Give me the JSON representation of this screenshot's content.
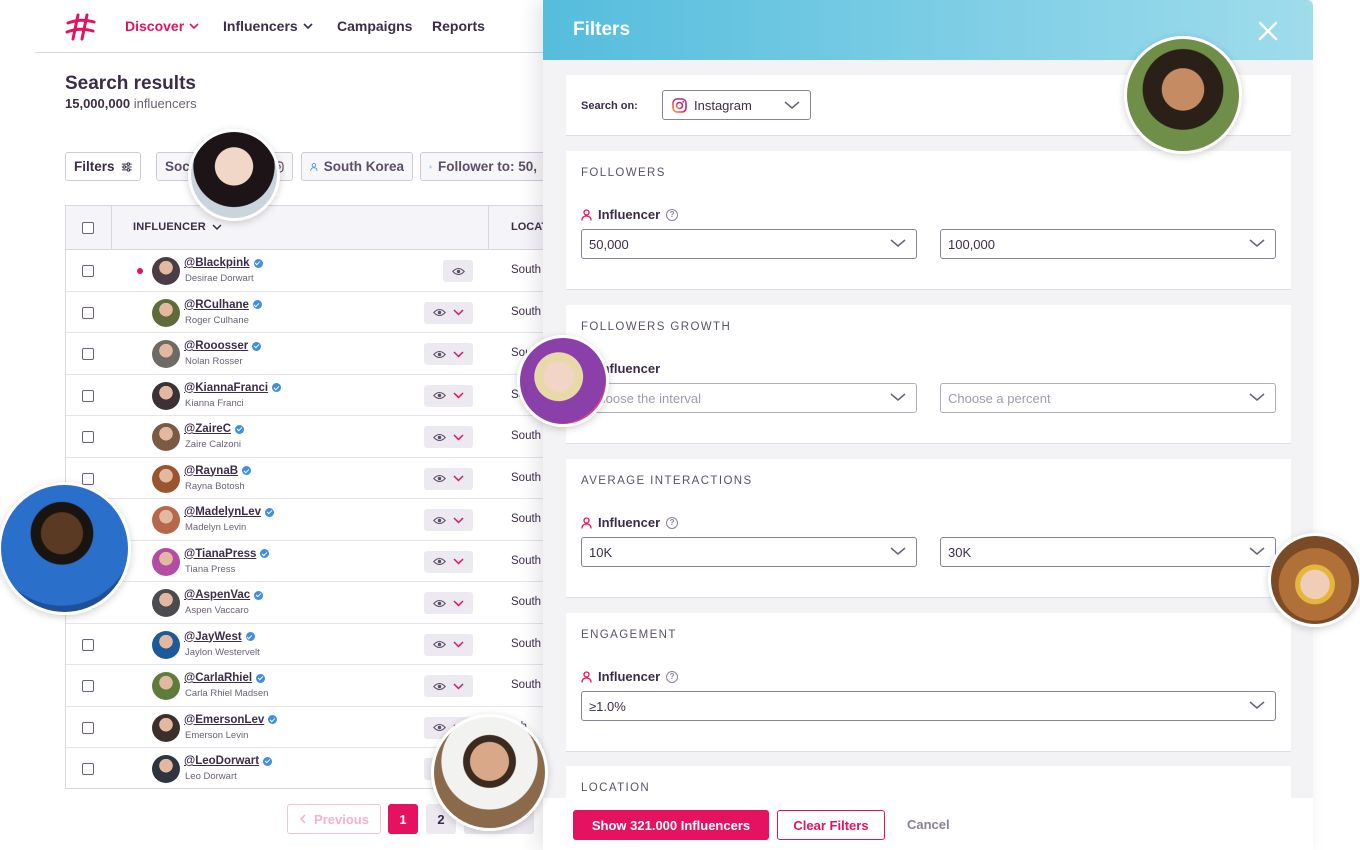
{
  "nav": {
    "items": [
      {
        "label": "Discover",
        "active": true,
        "dropdown": true
      },
      {
        "label": "Influencers",
        "active": false,
        "dropdown": true
      },
      {
        "label": "Campaigns",
        "active": false,
        "dropdown": false
      },
      {
        "label": "Reports",
        "active": false,
        "dropdown": false
      }
    ]
  },
  "results": {
    "title": "Search results",
    "count": "15,000,000",
    "count_suffix": "influencers"
  },
  "chips": {
    "filters": "Filters",
    "social": "Soci",
    "country": "South Korea",
    "followers": "Follower to: 50,"
  },
  "table": {
    "col_influencer": "INFLUENCER",
    "col_location": "LOCAT",
    "rows": [
      {
        "handle": "@Blackpink",
        "name": "Desirae Dorwart",
        "location": "South",
        "highlight": true,
        "color": "#4a3d46"
      },
      {
        "handle": "@RCulhane",
        "name": "Roger Culhane",
        "location": "South",
        "highlight": false,
        "color": "#5f6b3a"
      },
      {
        "handle": "@Rooosser",
        "name": "Nolan Rosser",
        "location": "Sou",
        "highlight": false,
        "color": "#6e6a66"
      },
      {
        "handle": "@KiannaFranci",
        "name": "Kianna Franci",
        "location": "So",
        "highlight": false,
        "color": "#3b3236"
      },
      {
        "handle": "@ZaireC",
        "name": "Zaire Calzoni",
        "location": "South",
        "highlight": false,
        "color": "#7a5a44"
      },
      {
        "handle": "@RaynaB",
        "name": "Rayna Botosh",
        "location": "South",
        "highlight": false,
        "color": "#9a5530"
      },
      {
        "handle": "@MadelynLev",
        "name": "Madelyn Levin",
        "location": "South",
        "highlight": false,
        "color": "#b7684a"
      },
      {
        "handle": "@TianaPress",
        "name": "Tiana Press",
        "location": "South",
        "highlight": false,
        "color": "#b34da3"
      },
      {
        "handle": "@AspenVac",
        "name": "Aspen Vaccaro",
        "location": "South",
        "highlight": false,
        "color": "#4b4b50"
      },
      {
        "handle": "@JayWest",
        "name": "Jaylon Westervelt",
        "location": "South",
        "highlight": false,
        "color": "#1d5a9a"
      },
      {
        "handle": "@CarlaRhiel",
        "name": "Carla Rhiel Madsen",
        "location": "South",
        "highlight": false,
        "color": "#5e7d3a"
      },
      {
        "handle": "@EmersonLev",
        "name": "Emerson Levin",
        "location": "uth",
        "highlight": false,
        "color": "#3a2f2a"
      },
      {
        "handle": "@LeoDorwart",
        "name": "Leo Dorwart",
        "location": "",
        "highlight": false,
        "color": "#2e3440"
      }
    ]
  },
  "pagination": {
    "previous": "Previous",
    "page1": "1",
    "page2": "2"
  },
  "panel": {
    "title": "Filters",
    "search_on_label": "Search on:",
    "platform": "Instagram",
    "sections": [
      {
        "title": "FOLLOWERS",
        "sub": "Influencer",
        "help": true,
        "min": "50,000",
        "max": "100,000",
        "placeholder": false
      },
      {
        "title": "FOLLOWERS GROWTH",
        "sub": "Influencer",
        "help": false,
        "min": "Choose the interval",
        "max": "Choose a percent",
        "placeholder": true
      },
      {
        "title": "AVERAGE INTERACTIONS",
        "sub": "Influencer",
        "help": true,
        "min": "10K",
        "max": "30K",
        "placeholder": false
      },
      {
        "title": "ENGAGEMENT",
        "sub": "Influencer",
        "help": true,
        "value": "≥1.0%",
        "placeholder": false
      }
    ],
    "location_title": "LOCATION",
    "show_button": "Show 321.000 Influencers",
    "clear_button": "Clear Filters",
    "cancel_button": "Cancel"
  },
  "colors": {
    "accent": "#e5125f",
    "header_gradient_start": "#55bddd",
    "header_gradient_end": "#9fdcec",
    "text": "#3b2c4a"
  }
}
